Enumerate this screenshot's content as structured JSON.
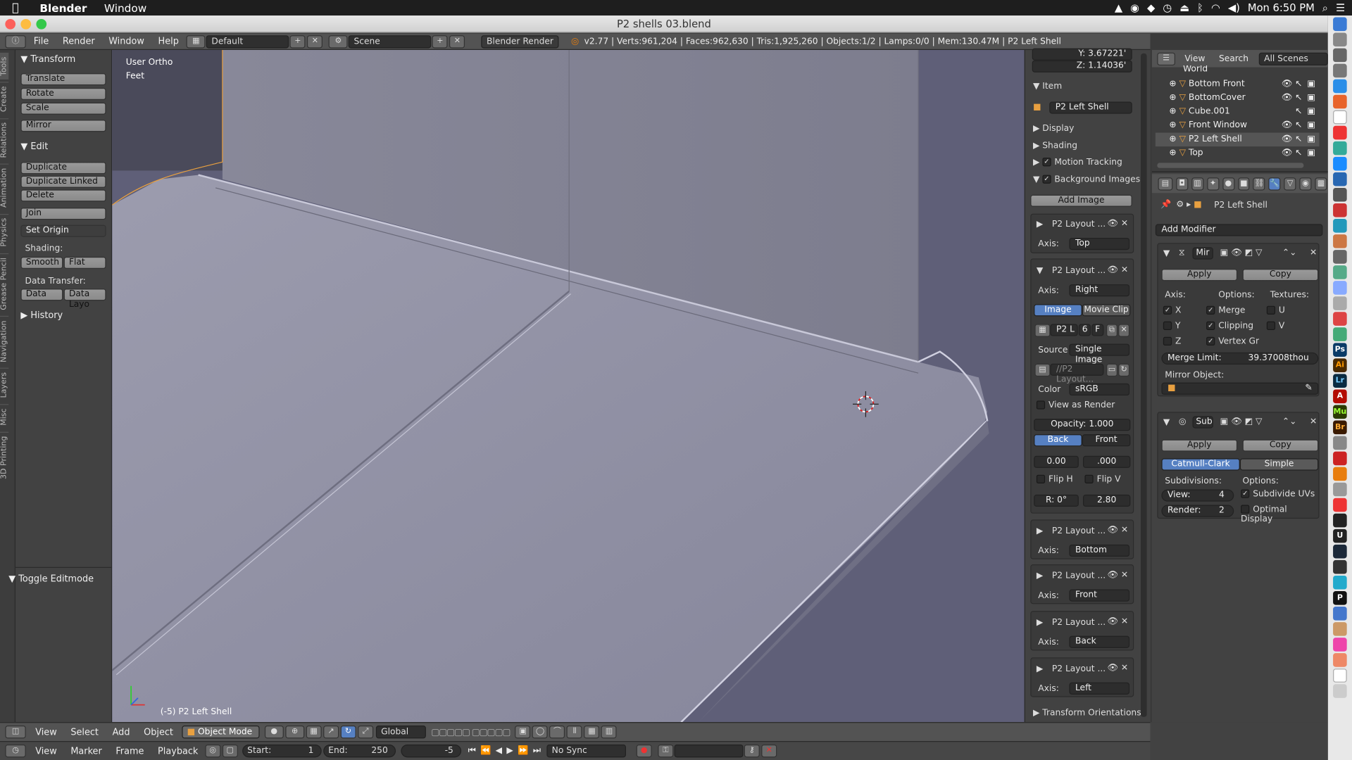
{
  "menubar": {
    "app": "Blender",
    "items": [
      "Window"
    ],
    "clock": "Mon 6:50 PM"
  },
  "window": {
    "title": "P2 shells 03.blend"
  },
  "header": {
    "menus": [
      "File",
      "Render",
      "Window",
      "Help"
    ],
    "layout": "Default",
    "scene": "Scene",
    "engine": "Blender Render",
    "stats": "v2.77 | Verts:961,204 | Faces:962,630 | Tris:1,925,260 | Objects:1/2 | Lamps:0/0 | Mem:130.47M | P2 Left Shell"
  },
  "tool_tabs": [
    "Tools",
    "Create",
    "Relations",
    "Animation",
    "Physics",
    "Grease Pencil",
    "Navigation",
    "Layers",
    "Misc",
    "3D Printing"
  ],
  "toolshelf": {
    "transform_title": "Transform",
    "translate": "Translate",
    "rotate": "Rotate",
    "scale": "Scale",
    "mirror": "Mirror",
    "edit_title": "Edit",
    "duplicate": "Duplicate",
    "duplicate_linked": "Duplicate Linked",
    "delete": "Delete",
    "join": "Join",
    "set_origin": "Set Origin",
    "shading_label": "Shading:",
    "smooth": "Smooth",
    "flat": "Flat",
    "data_transfer_label": "Data Transfer:",
    "data": "Data",
    "data_layo": "Data Layo",
    "history_title": "History",
    "toggle_editmode": "Toggle Editmode"
  },
  "viewport": {
    "view_name": "User Ortho",
    "units": "Feet",
    "object_label": "(-5) P2 Left Shell"
  },
  "npanel": {
    "y_field": "Y:           3.67221'",
    "z_field": "Z:           1.14036'",
    "item_title": "Item",
    "item_name": "P2 Left Shell",
    "display": "Display",
    "shading": "Shading",
    "motion_tracking": "Motion Tracking",
    "background_images": "Background Images",
    "add_image": "Add Image",
    "bg_items": [
      {
        "name": "P2 Layout ...",
        "axis": "Top"
      },
      {
        "name": "P2 Layout ...",
        "axis": "Right"
      },
      {
        "name": "P2 Layout ...",
        "axis": "Bottom"
      },
      {
        "name": "P2 Layout ...",
        "axis": "Front"
      },
      {
        "name": "P2 Layout ...",
        "axis": "Back"
      },
      {
        "name": "P2 Layout ...",
        "axis": "Left"
      }
    ],
    "axis_label": "Axis:",
    "image_tab": "Image",
    "movie_clip_tab": "Movie Clip",
    "img_name": "P2 L",
    "img_users": "6",
    "img_f": "F",
    "source_label": "Source",
    "source_value": "Single Image",
    "filepath": "//P2 Layout...",
    "color_label": "Color",
    "color_value": "sRGB",
    "view_as_render": "View as Render",
    "opacity": "Opacity:        1.000",
    "back": "Back",
    "front": "Front",
    "x_offset": "0.00",
    "y_offset": ".000",
    "flip_h": "Flip H",
    "flip_v": "Flip V",
    "rotation": "R: 0°",
    "size": "2.80",
    "transform_orientations": "Transform Orientations"
  },
  "outliner": {
    "menus": [
      "View",
      "Search"
    ],
    "filter": "All Scenes",
    "items": [
      "World",
      "Bottom Front",
      "BottomCover",
      "Cube.001",
      "Front Window",
      "P2 Left Shell",
      "Top"
    ]
  },
  "properties": {
    "object_name": "P2 Left Shell",
    "add_modifier": "Add Modifier",
    "mirror": {
      "name": "Mir",
      "apply": "Apply",
      "copy": "Copy",
      "axis_label": "Axis:",
      "options_label": "Options:",
      "textures_label": "Textures:",
      "x": "X",
      "y": "Y",
      "z": "Z",
      "merge": "Merge",
      "clipping": "Clipping",
      "vertex_gr": "Vertex Gr",
      "u": "U",
      "v": "V",
      "merge_limit": "Merge Limit:",
      "merge_limit_value": "39.37008thou",
      "mirror_object": "Mirror Object:"
    },
    "subsurf": {
      "name": "Sub",
      "apply": "Apply",
      "copy": "Copy",
      "catmull": "Catmull-Clark",
      "simple": "Simple",
      "subdivisions_label": "Subdivisions:",
      "options_label": "Options:",
      "view": "View:",
      "view_value": "4",
      "render": "Render:",
      "render_value": "2",
      "subdivide_uvs": "Subdivide UVs",
      "optimal_display": "Optimal Display"
    }
  },
  "bottombar": {
    "menus": [
      "View",
      "Select",
      "Add",
      "Object"
    ],
    "mode": "Object Mode",
    "orientation": "Global"
  },
  "timeline": {
    "menus": [
      "View",
      "Marker",
      "Frame",
      "Playback"
    ],
    "start_label": "Start:",
    "start": "1",
    "end_label": "End:",
    "end": "250",
    "current": "-5",
    "sync": "No Sync"
  }
}
